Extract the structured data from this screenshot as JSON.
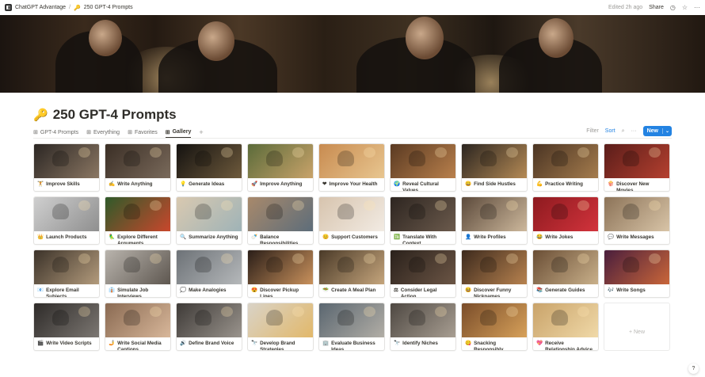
{
  "topbar": {
    "workspace": "ChatGPT Advantage",
    "separator": "/",
    "page_icon": "🔑",
    "page": "250 GPT-4 Prompts",
    "edited": "Edited 2h ago",
    "share": "Share",
    "clock_icon": "clock-icon",
    "star_icon": "star-icon",
    "more_icon": "more-icon"
  },
  "page": {
    "icon": "🔑",
    "title": "250 GPT-4 Prompts"
  },
  "views": [
    {
      "icon": "⊞",
      "label": "GPT-4 Prompts"
    },
    {
      "icon": "⊞",
      "label": "Everything"
    },
    {
      "icon": "⊞",
      "label": "Favorites"
    },
    {
      "icon": "⊞",
      "label": "Gallery"
    }
  ],
  "active_view": "Gallery",
  "view_add": "+",
  "actions": {
    "filter": "Filter",
    "sort": "Sort",
    "new": "New",
    "caret": "⌄"
  },
  "cards": [
    {
      "emoji": "🏋",
      "label": "Improve Skills",
      "c1": "#2b2623",
      "c2": "#8b7763"
    },
    {
      "emoji": "✍",
      "label": "Write Anything",
      "c1": "#3a2e25",
      "c2": "#7a6a5b"
    },
    {
      "emoji": "💡",
      "label": "Generate Ideas",
      "c1": "#141210",
      "c2": "#6e5a3c"
    },
    {
      "emoji": "🚀",
      "label": "Improve Anything",
      "c1": "#5b6b3a",
      "c2": "#c9a36a"
    },
    {
      "emoji": "❤",
      "label": "Improve Your Health",
      "c1": "#c88b50",
      "c2": "#e8c690"
    },
    {
      "emoji": "🌍",
      "label": "Reveal Cultural Values",
      "c1": "#5a3a22",
      "c2": "#b9804c"
    },
    {
      "emoji": "😀",
      "label": "Find Side Hustles",
      "c1": "#2b2520",
      "c2": "#b58a55"
    },
    {
      "emoji": "💪",
      "label": "Practice Writing",
      "c1": "#4a3423",
      "c2": "#a57c4d"
    },
    {
      "emoji": "🍿",
      "label": "Discover New Movies",
      "c1": "#5a1d1a",
      "c2": "#b5402f"
    },
    {
      "emoji": "👑",
      "label": "Launch Products",
      "c1": "#cfcfcf",
      "c2": "#8f8f8f"
    },
    {
      "emoji": "🦜",
      "label": "Explore Different Arguments",
      "c1": "#2f5a2a",
      "c2": "#c9472c"
    },
    {
      "emoji": "🔍",
      "label": "Summarize Anything",
      "c1": "#d9c9b0",
      "c2": "#9fb3b7"
    },
    {
      "emoji": "🍼",
      "label": "Balance Responsibilities",
      "c1": "#a8896b",
      "c2": "#5d6d7a"
    },
    {
      "emoji": "😊",
      "label": "Support Customers",
      "c1": "#d7c4ae",
      "c2": "#f2ebe3"
    },
    {
      "emoji": "🈯",
      "label": "Translate With Context",
      "c1": "#2d2520",
      "c2": "#6b5a4c"
    },
    {
      "emoji": "👤",
      "label": "Write Profiles",
      "c1": "#5c4a3b",
      "c2": "#cdb89c"
    },
    {
      "emoji": "😂",
      "label": "Write Jokes",
      "c1": "#8d1a1f",
      "c2": "#d2333c"
    },
    {
      "emoji": "💬",
      "label": "Write Messages",
      "c1": "#8c7358",
      "c2": "#d8c4a7"
    },
    {
      "emoji": "📧",
      "label": "Explore Email Subjects",
      "c1": "#3b3229",
      "c2": "#b39b7c"
    },
    {
      "emoji": "👔",
      "label": "Simulate Job Interviews",
      "c1": "#b9b4ad",
      "c2": "#5e5750"
    },
    {
      "emoji": "💭",
      "label": "Make Analogies",
      "c1": "#6d7277",
      "c2": "#b5b8ba"
    },
    {
      "emoji": "😍",
      "label": "Discover Pickup Lines",
      "c1": "#2a1e18",
      "c2": "#c9915c"
    },
    {
      "emoji": "🥗",
      "label": "Create A Meal Plan",
      "c1": "#4a3a28",
      "c2": "#c5a57c"
    },
    {
      "emoji": "⚖",
      "label": "Consider Legal Action",
      "c1": "#2a211b",
      "c2": "#6b5545"
    },
    {
      "emoji": "😆",
      "label": "Discover Funny Nicknames",
      "c1": "#3d2a1d",
      "c2": "#b7824f"
    },
    {
      "emoji": "📚",
      "label": "Generate Guides",
      "c1": "#6a4e35",
      "c2": "#c9b08a"
    },
    {
      "emoji": "🎶",
      "label": "Write Songs",
      "c1": "#4a1e3c",
      "c2": "#c9663a"
    },
    {
      "emoji": "🎬",
      "label": "Write Video Scripts",
      "c1": "#2e2b29",
      "c2": "#7c7772"
    },
    {
      "emoji": "🤳",
      "label": "Write Social Media Captions",
      "c1": "#8a6a52",
      "c2": "#d8b79a"
    },
    {
      "emoji": "🔊",
      "label": "Define Brand Voice",
      "c1": "#3e3a37",
      "c2": "#9a948d"
    },
    {
      "emoji": "🔭",
      "label": "Develop Brand Strategies",
      "c1": "#d9d3c7",
      "c2": "#e2b86a"
    },
    {
      "emoji": "🏢",
      "label": "Evaluate Business Ideas",
      "c1": "#5a6670",
      "c2": "#b2aea6"
    },
    {
      "emoji": "🔭",
      "label": "Identify Niches",
      "c1": "#4e4842",
      "c2": "#a89e92"
    },
    {
      "emoji": "😋",
      "label": "Snacking Responsibly",
      "c1": "#7a4d2a",
      "c2": "#d7a15a"
    },
    {
      "emoji": "💖",
      "label": "Receive Relationship Advice",
      "c1": "#c9a36a",
      "c2": "#f0d9a8"
    }
  ],
  "new_card_label": "+ New",
  "help": "?"
}
